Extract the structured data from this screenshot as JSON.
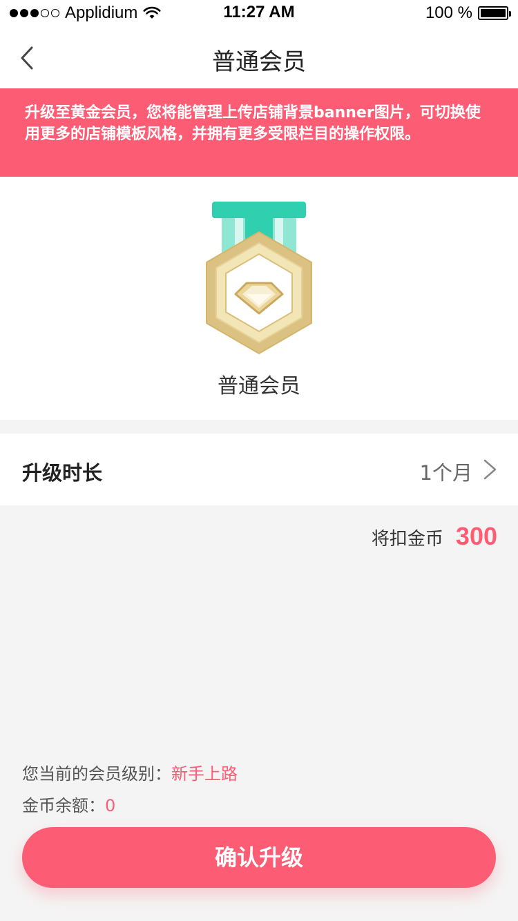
{
  "status_bar": {
    "carrier": "Applidium",
    "time": "11:27 AM",
    "battery": "100 %",
    "signal_icon": "signal-dots-icon",
    "wifi_icon": "wifi-icon",
    "battery_icon": "battery-icon"
  },
  "nav": {
    "title": "普通会员",
    "back_icon": "chevron-left-icon"
  },
  "notice": {
    "text": "升级至黄金会员，您将能管理上传店铺背景banner图片，可切换使用更多的店铺模板风格，并拥有更多受限栏目的操作权限。"
  },
  "medal": {
    "icon": "diamond-medal-icon",
    "label": "普通会员"
  },
  "upgrade": {
    "duration_label": "升级时长",
    "duration_value": "1个月",
    "chevron_icon": "chevron-right-icon"
  },
  "deduct": {
    "label": "将扣金币",
    "amount": "300"
  },
  "info": {
    "level_label": "您当前的会员级别：",
    "level_value": "新手上路",
    "balance_label": "金币余额：",
    "balance_value": "0"
  },
  "confirm_button": "确认升级",
  "colors": {
    "accent": "#fd5d74",
    "ribbon": "#2fcfb0",
    "gold": "#dcc282"
  }
}
